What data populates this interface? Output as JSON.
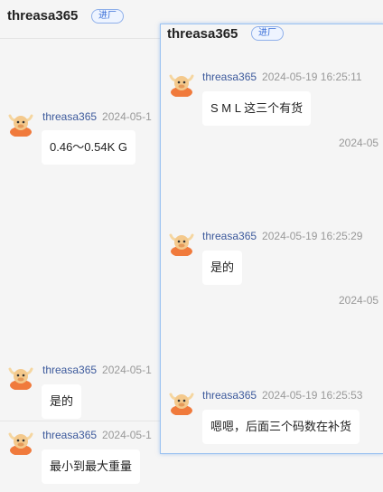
{
  "header": {
    "title": "threasa365",
    "tag": "进厂"
  },
  "background_messages": [
    {
      "name": "threasa365",
      "time": "2024-05-1",
      "text": "0.46～0.54K G"
    },
    {
      "name": "threasa365",
      "time": "2024-05-1",
      "text": "是的"
    },
    {
      "name": "threasa365",
      "time": "2024-05-1",
      "text": "最小到最大重量"
    }
  ],
  "panel": {
    "title": "threasa365",
    "tag": "进厂",
    "messages": [
      {
        "name": "threasa365",
        "time": "2024-05-19 16:25:11",
        "text": "S M L 这三个有货"
      },
      {
        "name": "threasa365",
        "time": "2024-05-19 16:25:29",
        "text": "是的"
      },
      {
        "name": "threasa365",
        "time": "2024-05-19 16:25:53",
        "text": "嗯嗯，后面三个码数在补货"
      }
    ],
    "date_stamps": [
      "2024-05",
      "2024-05"
    ]
  },
  "icons": {
    "avatar": "bull-mascot-avatar-icon"
  },
  "colors": {
    "accent": "#3a6fd8",
    "name": "#3d5a9c",
    "avatar": "#f07a3c"
  }
}
